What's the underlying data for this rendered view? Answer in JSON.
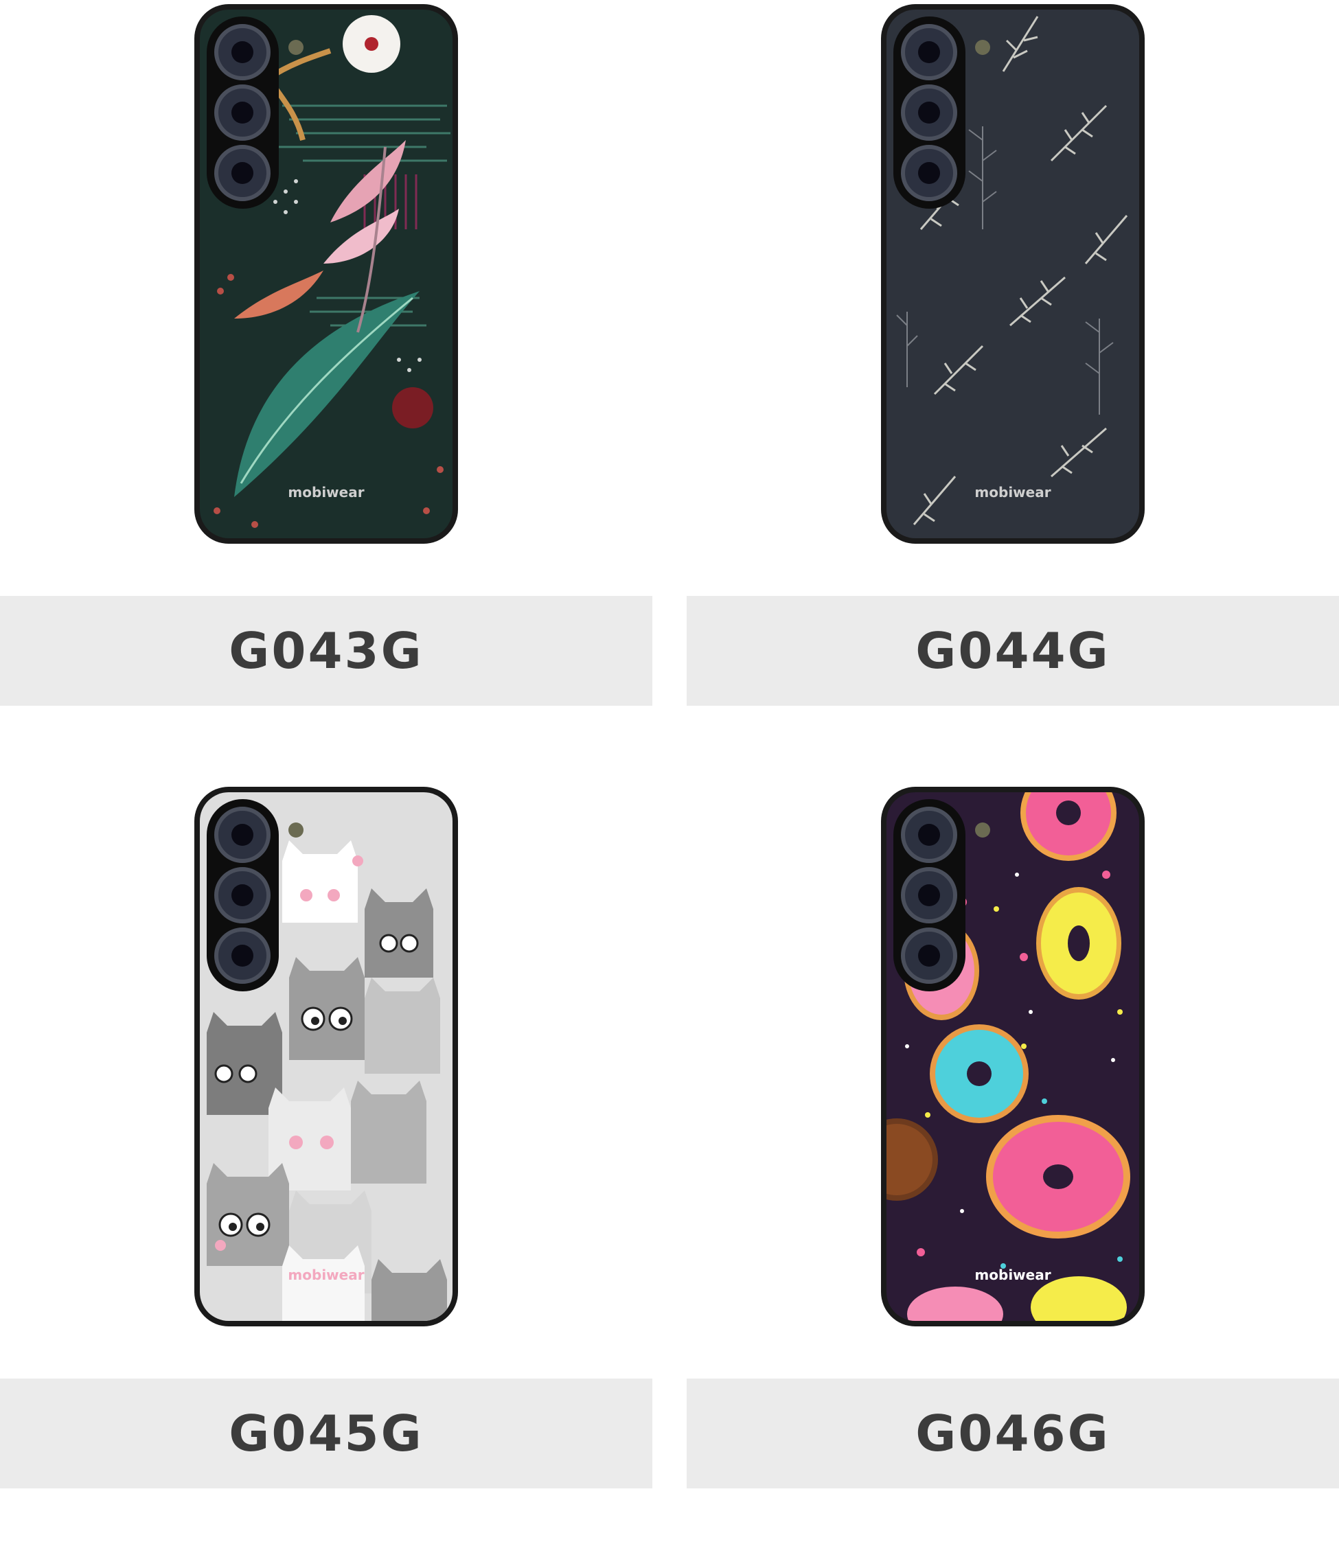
{
  "products": [
    {
      "code": "G043G",
      "brand": "mobiwear",
      "pattern_icon": "tropical-jungle-pattern",
      "case_color": "#1b2f2b",
      "accent_color": "#e6a3b4"
    },
    {
      "code": "G044G",
      "brand": "mobiwear",
      "pattern_icon": "grey-leaf-pattern",
      "case_color": "#2e333c",
      "accent_color": "#c9c9c2"
    },
    {
      "code": "G045G",
      "brand": "mobiwear",
      "pattern_icon": "grey-cats-pattern",
      "case_color": "#dedede",
      "accent_color": "#f3a8bf"
    },
    {
      "code": "G046G",
      "brand": "mobiwear",
      "pattern_icon": "donuts-pattern",
      "case_color": "#2b1b35",
      "accent_color": "#f25f97"
    }
  ],
  "colors": {
    "label_background": "#ebebeb",
    "label_text": "#3c3c3c"
  }
}
